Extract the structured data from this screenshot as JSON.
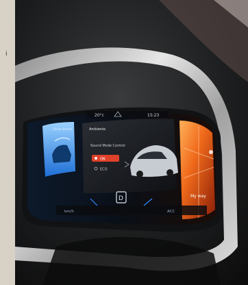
{
  "side_mark": "i",
  "cluster": {
    "top_bar": {
      "left": "20°c",
      "right": "15:23"
    },
    "left_panel_title": "Drive Assist",
    "center_title": "Ambiente",
    "center_subtitle": "Sound Mode Control",
    "menu_item_1": "ON",
    "menu_item_2": "ECO",
    "bottom_left": "km/h",
    "bottom_center": "D",
    "bottom_right": "ACC",
    "right_panel_label": "My way"
  },
  "colors": {
    "accent_blue": "#2f8cff",
    "accent_orange": "#ff7a1a",
    "accent_red": "#e0412b"
  }
}
